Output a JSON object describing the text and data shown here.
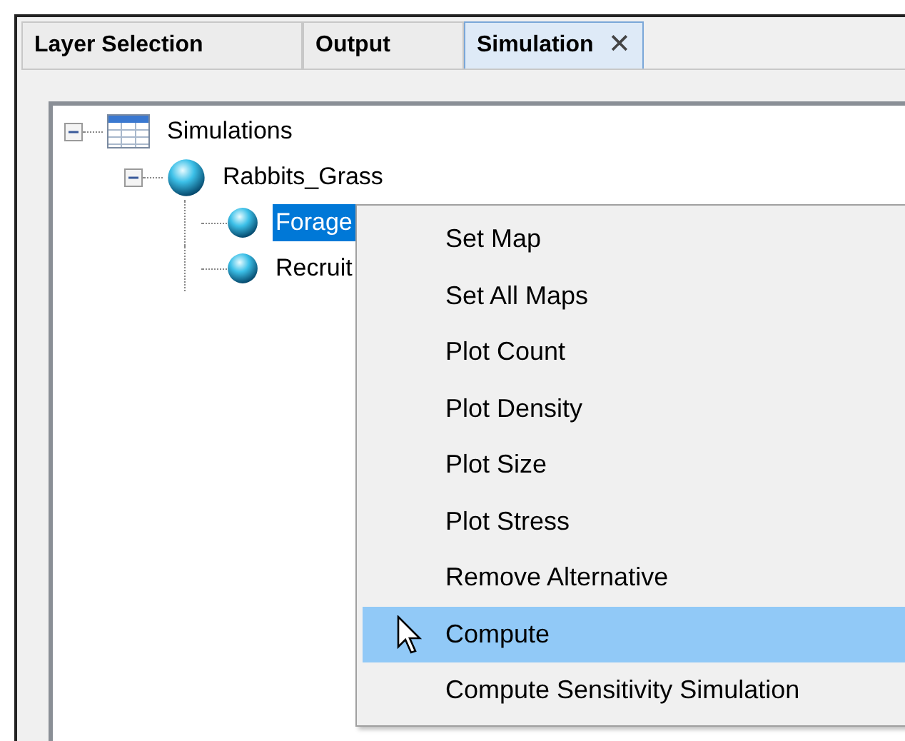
{
  "tabs": [
    {
      "label": "Layer Selection",
      "selected": false
    },
    {
      "label": "Output",
      "selected": false
    },
    {
      "label": "Simulation",
      "selected": true,
      "close": "✕"
    }
  ],
  "tree": [
    {
      "label": "Simulations",
      "kind": "table",
      "expanded": true,
      "selected": false,
      "children": [
        {
          "label": "Rabbits_Grass",
          "kind": "sphere",
          "expanded": true,
          "selected": false,
          "children": [
            {
              "label": "Forage",
              "kind": "small-sphere",
              "selected": true
            },
            {
              "label": "Recruit",
              "kind": "small-sphere",
              "selected": false
            }
          ]
        }
      ]
    }
  ],
  "context_menu": {
    "items": [
      {
        "label": "Set Map",
        "selected": false
      },
      {
        "label": "Set All Maps",
        "selected": false
      },
      {
        "label": "Plot Count",
        "selected": false
      },
      {
        "label": "Plot Density",
        "selected": false
      },
      {
        "label": "Plot Size",
        "selected": false
      },
      {
        "label": "Plot Stress",
        "selected": false
      },
      {
        "label": "Remove Alternative",
        "selected": false
      },
      {
        "label": "Compute",
        "selected": true
      },
      {
        "label": "Compute Sensitivity Simulation",
        "selected": false
      }
    ]
  }
}
